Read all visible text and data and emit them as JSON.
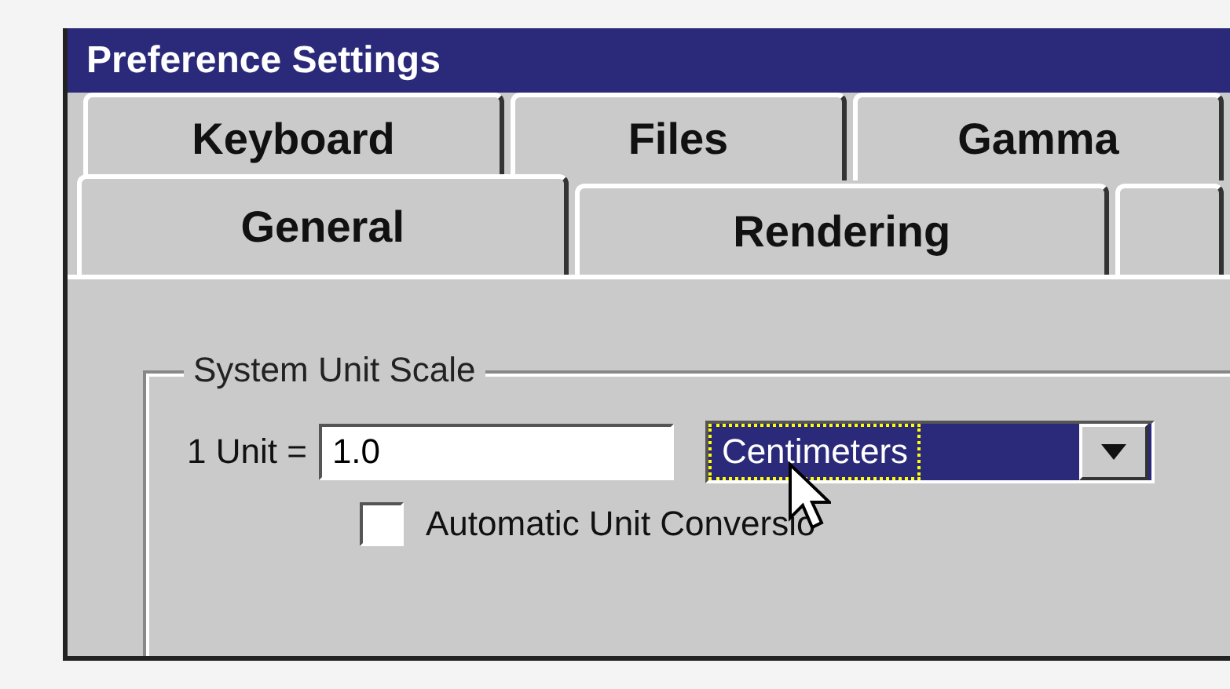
{
  "window": {
    "title": "Preference Settings"
  },
  "tabs": {
    "back_row": [
      {
        "label": "Keyboard",
        "selected": false
      },
      {
        "label": "Files",
        "selected": false
      },
      {
        "label": "Gamma",
        "selected": false
      }
    ],
    "front_row": [
      {
        "label": "General",
        "selected": true
      },
      {
        "label": "Rendering",
        "selected": false
      }
    ]
  },
  "group": {
    "title": "System Unit Scale",
    "unit_label": "1 Unit =",
    "unit_value": "1.0",
    "unit_type": {
      "value": "Centimeters",
      "focused": true
    },
    "checkbox": {
      "label": "Automatic Unit Conversio",
      "checked": false
    }
  }
}
